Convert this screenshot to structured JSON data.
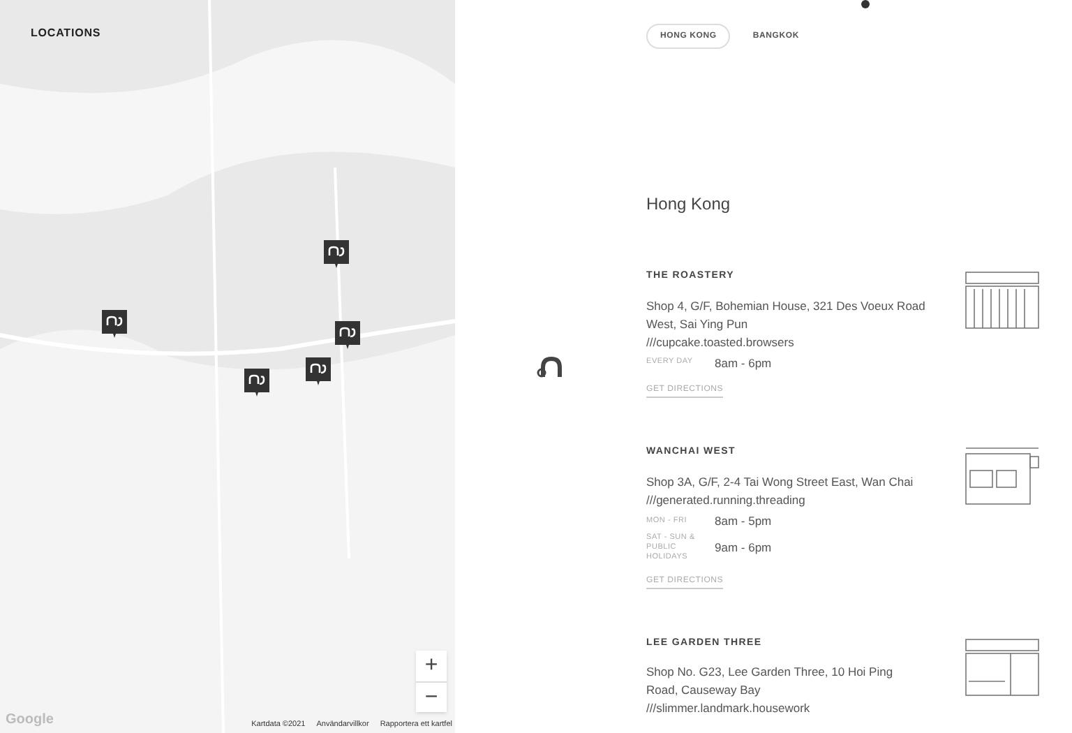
{
  "map": {
    "heading": "LOCATIONS",
    "zoom_in": "+",
    "zoom_out": "−",
    "logo": "Google",
    "attribution": [
      "Kartdata ©2021",
      "Användarvillkor",
      "Rapportera ett kartfel"
    ]
  },
  "tabs": [
    {
      "label": "HONG KONG",
      "selected": true
    },
    {
      "label": "BANGKOK",
      "selected": false
    }
  ],
  "city": "Hong Kong",
  "stores": [
    {
      "name": "THE ROASTERY",
      "address": "Shop 4, G/F, Bohemian House, 321 Des Voeux Road West, Sai Ying Pun",
      "code": "///cupcake.toasted.browsers",
      "hours": [
        {
          "days": "EVERY DAY",
          "time": "8am - 6pm"
        }
      ],
      "link": "GET DIRECTIONS",
      "kind": "roastery"
    },
    {
      "name": "WANCHAI WEST",
      "address": "Shop 3A, G/F, 2-4 Tai Wong Street East, Wan Chai",
      "code": "///generated.running.threading",
      "hours": [
        {
          "days": "MON - FRI",
          "time": "8am - 5pm"
        },
        {
          "days": "SAT - SUN & PUBLIC HOLIDAYS",
          "time": "9am - 6pm"
        }
      ],
      "link": "GET DIRECTIONS",
      "kind": "wanchai"
    },
    {
      "name": "LEE GARDEN THREE",
      "address": "Shop No. G23, Lee Garden Three, 10 Hoi Ping Road, Causeway Bay",
      "code": "///slimmer.landmark.housework",
      "kind": "leegarden"
    }
  ]
}
